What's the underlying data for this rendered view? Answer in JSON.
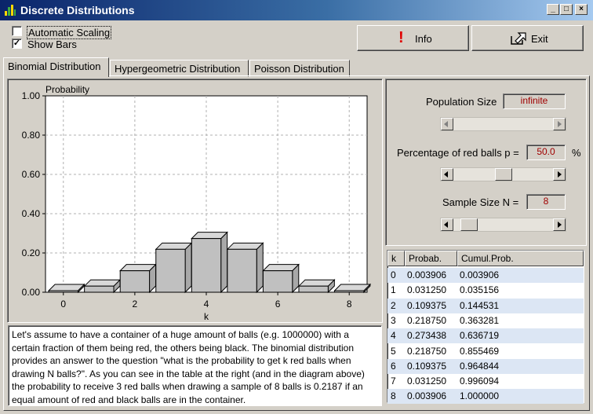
{
  "window": {
    "title": "Discrete Distributions",
    "icon": "app-distribution-icon"
  },
  "options": {
    "automatic_scaling": {
      "label": "Automatic Scaling",
      "checked": false
    },
    "show_bars": {
      "label": "Show Bars",
      "checked": true
    }
  },
  "buttons": {
    "info": {
      "label": "Info",
      "icon": "exclamation-icon"
    },
    "exit": {
      "label": "Exit",
      "icon": "exit-arrow-icon"
    }
  },
  "tabs": [
    {
      "label": "Binomial Distribution",
      "active": true
    },
    {
      "label": "Hypergeometric Distribution",
      "active": false
    },
    {
      "label": "Poisson Distribution",
      "active": false
    }
  ],
  "controls": {
    "population_size": {
      "label": "Population Size",
      "value": "infinite"
    },
    "percentage": {
      "label": "Percentage of red balls p =",
      "value": "50.0",
      "unit": "%"
    },
    "sample_size": {
      "label": "Sample Size N =",
      "value": "8"
    }
  },
  "chart_data": {
    "type": "bar",
    "ylabel": "Probability",
    "xlabel": "k",
    "ylim": [
      0,
      1.0
    ],
    "yticks": [
      "0.00",
      "0.20",
      "0.40",
      "0.60",
      "0.80",
      "1.00"
    ],
    "xticks": [
      "0",
      "2",
      "4",
      "6",
      "8"
    ],
    "categories": [
      0,
      1,
      2,
      3,
      4,
      5,
      6,
      7,
      8
    ],
    "values": [
      0.003906,
      0.03125,
      0.109375,
      0.21875,
      0.273438,
      0.21875,
      0.109375,
      0.03125,
      0.003906
    ],
    "grid": true,
    "bar_color": "#c0c0c0"
  },
  "table": {
    "headers": [
      "k",
      "Probab.",
      "Cumul.Prob."
    ],
    "rows": [
      [
        "0",
        "0.003906",
        "0.003906"
      ],
      [
        "1",
        "0.031250",
        "0.035156"
      ],
      [
        "2",
        "0.109375",
        "0.144531"
      ],
      [
        "3",
        "0.218750",
        "0.363281"
      ],
      [
        "4",
        "0.273438",
        "0.636719"
      ],
      [
        "5",
        "0.218750",
        "0.855469"
      ],
      [
        "6",
        "0.109375",
        "0.964844"
      ],
      [
        "7",
        "0.031250",
        "0.996094"
      ],
      [
        "8",
        "0.003906",
        "1.000000"
      ]
    ]
  },
  "description": "Let's assume to have a container of a huge amount of balls (e.g. 1000000) with a certain fraction of them being red, the others being black. The binomial distribution provides an answer to the question \"what is the probability to get k red balls when drawing N balls?\". As you can see in the table at the right (and in the diagram above) the probability to receive 3 red balls when drawing a sample of 8 balls is 0.2187 if an equal amount of red and black balls are in the container."
}
